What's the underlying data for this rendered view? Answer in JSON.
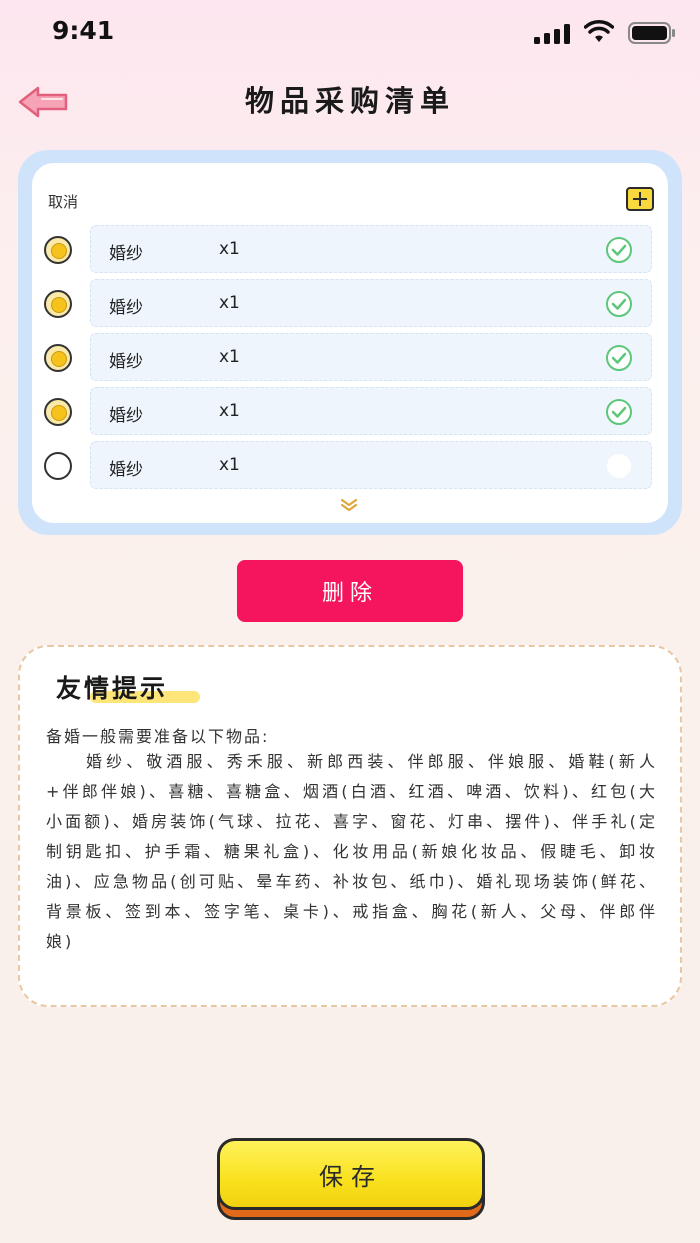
{
  "status_bar": {
    "time": "9:41"
  },
  "header": {
    "title": "物品采购清单"
  },
  "list": {
    "cancel_label": "取消",
    "items": [
      {
        "name": "婚纱",
        "qty": "x1",
        "selected": true,
        "done": true
      },
      {
        "name": "婚纱",
        "qty": "x1",
        "selected": true,
        "done": true
      },
      {
        "name": "婚纱",
        "qty": "x1",
        "selected": true,
        "done": true
      },
      {
        "name": "婚纱",
        "qty": "x1",
        "selected": true,
        "done": true
      },
      {
        "name": "婚纱",
        "qty": "x1",
        "selected": false,
        "done": false
      }
    ]
  },
  "actions": {
    "delete_label": "删除",
    "save_label": "保存"
  },
  "tips": {
    "title": "友情提示",
    "intro": "备婚一般需要准备以下物品:",
    "body": "婚纱、敬酒服、秀禾服、新郎西装、伴郎服、伴娘服、婚鞋(新人+伴郎伴娘)、喜糖、喜糖盒、烟酒(白酒、红酒、啤酒、饮料)、红包(大小面额)、婚房装饰(气球、拉花、喜字、窗花、灯串、摆件)、伴手礼(定制钥匙扣、护手霜、糖果礼盒)、化妆用品(新娘化妆品、假睫毛、卸妆油)、应急物品(创可贴、晕车药、补妆包、纸巾)、婚礼现场装饰(鲜花、背景板、签到本、签字笔、桌卡)、戒指盒、胸花(新人、父母、伴郎伴娘)"
  },
  "colors": {
    "accent_red": "#f5155e",
    "save_yellow": "#f9e11e",
    "list_frame": "#cfe4fb",
    "check_green": "#5cc77a"
  }
}
